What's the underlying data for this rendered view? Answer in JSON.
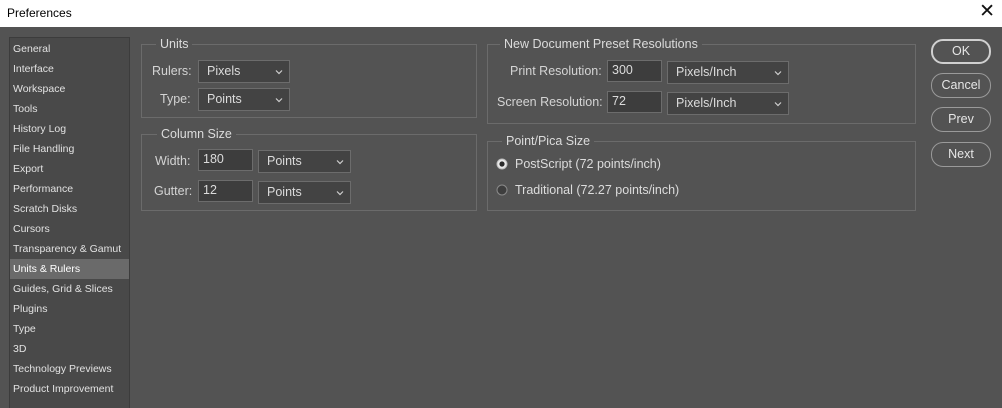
{
  "window": {
    "title": "Preferences",
    "close_glyph": "✕"
  },
  "sidebar": {
    "items": [
      {
        "label": "General"
      },
      {
        "label": "Interface"
      },
      {
        "label": "Workspace"
      },
      {
        "label": "Tools"
      },
      {
        "label": "History Log"
      },
      {
        "label": "File Handling"
      },
      {
        "label": "Export"
      },
      {
        "label": "Performance"
      },
      {
        "label": "Scratch Disks"
      },
      {
        "label": "Cursors"
      },
      {
        "label": "Transparency & Gamut"
      },
      {
        "label": "Units & Rulers",
        "selected": true
      },
      {
        "label": "Guides, Grid & Slices"
      },
      {
        "label": "Plugins"
      },
      {
        "label": "Type"
      },
      {
        "label": "3D"
      },
      {
        "label": "Technology Previews"
      },
      {
        "label": "Product Improvement"
      }
    ]
  },
  "units": {
    "legend": "Units",
    "rulers_label": "Rulers:",
    "rulers_value": "Pixels",
    "type_label": "Type:",
    "type_value": "Points"
  },
  "column_size": {
    "legend": "Column Size",
    "width_label": "Width:",
    "width_value": "180",
    "width_unit": "Points",
    "gutter_label": "Gutter:",
    "gutter_value": "12",
    "gutter_unit": "Points"
  },
  "preset_resolutions": {
    "legend": "New Document Preset Resolutions",
    "print_label": "Print Resolution:",
    "print_value": "300",
    "print_unit": "Pixels/Inch",
    "screen_label": "Screen Resolution:",
    "screen_value": "72",
    "screen_unit": "Pixels/Inch"
  },
  "point_pica": {
    "legend": "Point/Pica Size",
    "options": [
      {
        "label": "PostScript (72 points/inch)",
        "checked": true
      },
      {
        "label": "Traditional (72.27 points/inch)",
        "checked": false
      }
    ]
  },
  "buttons": {
    "ok": "OK",
    "cancel": "Cancel",
    "prev": "Prev",
    "next": "Next"
  },
  "colors": {
    "background": "#535353",
    "sidebar": "#494949",
    "selected": "#6a6a6a"
  }
}
